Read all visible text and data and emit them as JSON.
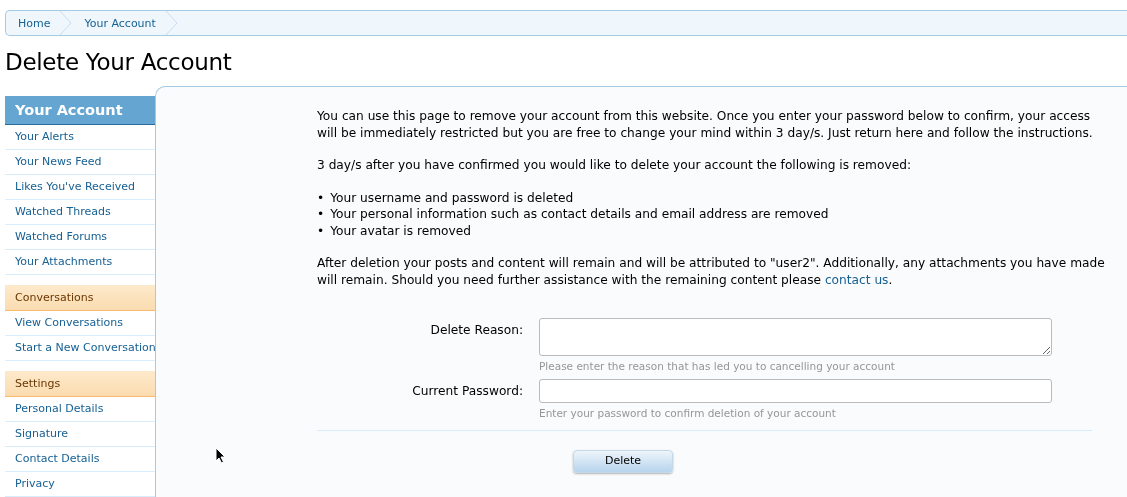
{
  "breadcrumb": [
    {
      "label": "Home"
    },
    {
      "label": "Your Account"
    }
  ],
  "title": "Delete Your Account",
  "sidebar": {
    "title": "Your Account",
    "items": [
      {
        "kind": "link",
        "label": "Your Alerts"
      },
      {
        "kind": "link",
        "label": "Your News Feed"
      },
      {
        "kind": "link",
        "label": "Likes You've Received"
      },
      {
        "kind": "link",
        "label": "Watched Threads"
      },
      {
        "kind": "link",
        "label": "Watched Forums"
      },
      {
        "kind": "link",
        "label": "Your Attachments"
      },
      {
        "kind": "section",
        "label": "Conversations"
      },
      {
        "kind": "link",
        "label": "View Conversations"
      },
      {
        "kind": "link",
        "label": "Start a New Conversation"
      },
      {
        "kind": "section",
        "label": "Settings"
      },
      {
        "kind": "link",
        "label": "Personal Details"
      },
      {
        "kind": "link",
        "label": "Signature"
      },
      {
        "kind": "link",
        "label": "Contact Details"
      },
      {
        "kind": "link",
        "label": "Privacy"
      }
    ]
  },
  "intro": "You can use this page to remove your account from this website. Once you enter your password below to confirm, your access will be immediately restricted but you are free to change your mind within 3 day/s. Just return here and follow the instructions.",
  "removed_intro": "3 day/s after you have confirmed you would like to delete your account the following is removed:",
  "removed_items": [
    {
      "bullet": "•",
      "text": "Your username and password is deleted"
    },
    {
      "bullet": "•",
      "text": "Your personal information such as contact details and email address are removed"
    },
    {
      "bullet": "•",
      "text": "Your avatar is removed"
    }
  ],
  "note": {
    "text": "After deletion your posts and content will remain and will be attributed to \"user2\". Additionally, any attachments you have made will remain. Should you need further assistance with the remaining content please ",
    "link": "contact us",
    "after": "."
  },
  "form": {
    "fields": [
      {
        "kind": "textarea",
        "label": "Delete Reason:",
        "hint": "Please enter the reason that has led you to cancelling your account"
      },
      {
        "kind": "password",
        "label": "Current Password:",
        "hint": "Enter your password to confirm deletion of your account"
      }
    ],
    "button": "Delete"
  }
}
